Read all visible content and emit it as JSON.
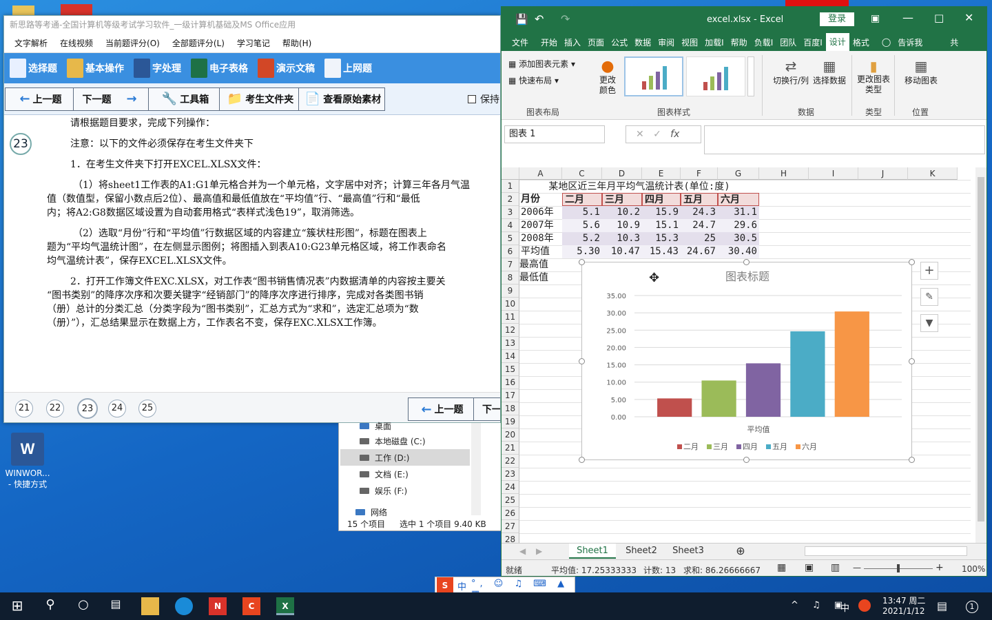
{
  "exam": {
    "title": "新思路等考通-全国计算机等级考试学习软件_一级计算机基础及MS Office应用",
    "menu": [
      "文字解析",
      "在线视频",
      "当前题评分(O)",
      "全部题评分(L)",
      "学习笔记",
      "帮助(H)"
    ],
    "modules": [
      "选择题",
      "基本操作",
      "字处理",
      "电子表格",
      "演示文稿",
      "上网题"
    ],
    "nav": {
      "prev": "上一题",
      "next": "下一题",
      "toolbox": "工具箱",
      "examfolder": "考生文件夹",
      "original": "查看原始素材",
      "keep": "保持"
    },
    "question_number": "23",
    "lines": [
      "请根据题目要求，完成下列操作：",
      "注意：以下的文件必须保存在考生文件夹下",
      "1．在考生文件夹下打开EXCEL.XLSX文件：",
      "（1）将sheet1工作表的A1:G1单元格合并为一个单元格，文字居中对齐；计算三年各月气温",
      "值（数值型，保留小数点后2位）、最高值和最低值放在“平均值”行、“最高值”行和“最低",
      "内；将A2:G8数据区域设置为自动套用格式“表样式浅色19”，取消筛选。",
      "（2）选取“月份”行和“平均值”行数据区域的内容建立“簇状柱形图”，标题在图表上",
      "题为“平均气温统计图”，在左侧显示图例；将图插入到表A10:G23单元格区域，将工作表命名",
      "均气温统计表”，保存EXCEL.XLSX文件。",
      "2．打开工作簿文件EXC.XLSX，对工作表“图书销售情况表”内数据清单的内容按主要关",
      "“图书类别”的降序次序和次要关键字“经销部门”的降序次序进行排序，完成对各类图书销",
      "（册）总计的分类汇总（分类字段为“图书类别”，汇总方式为“求和”，选定汇总项为“数",
      "（册）”），汇总结果显示在数据上方，工作表名不变，保存EXC.XLSX工作簿。"
    ],
    "pages": [
      "21",
      "22",
      "23",
      "24",
      "25"
    ],
    "footer_prev": "上一题",
    "footer_next": "下一"
  },
  "explorer": {
    "items": [
      "桌面",
      "本地磁盘 (C:)",
      "工作 (D:)",
      "文档 (E:)",
      "娱乐 (F:)",
      "网络"
    ],
    "status_count": "15 个项目",
    "status_selected": "选中 1 个项目  9.40 KB"
  },
  "desktop": {
    "word_label": "WINWOR...",
    "word_sub": "- 快捷方式"
  },
  "excel": {
    "title": "excel.xlsx  -  Excel",
    "login": "登录",
    "tabs": [
      "文件",
      "开始",
      "插入",
      "页面",
      "公式",
      "数据",
      "审阅",
      "视图",
      "加载I",
      "帮助",
      "负载I",
      "团队",
      "百度I",
      "设计",
      "格式"
    ],
    "tell": "告诉我",
    "share": "共",
    "ribbon": {
      "add_element": "添加图表元素",
      "quick_layout": "快速布局",
      "change_color": "更改颜色",
      "switch_rowcol": "切换行/列",
      "select_data": "选择数据",
      "change_type": "更改图表类型",
      "move_chart": "移动图表",
      "groups": [
        "图表布局",
        "图表样式",
        "数据",
        "类型",
        "位置"
      ]
    },
    "namebox": "图表 1",
    "fx": "fx",
    "columns": [
      "A",
      "C",
      "D",
      "E",
      "F",
      "G",
      "H",
      "I",
      "J",
      "K"
    ],
    "rows": [
      "1",
      "2",
      "3",
      "4",
      "5",
      "6",
      "7",
      "8",
      "9",
      "10",
      "11",
      "12",
      "13",
      "14",
      "15",
      "16",
      "17",
      "18",
      "19",
      "20",
      "21",
      "22",
      "23",
      "24",
      "25",
      "26",
      "27",
      "28"
    ],
    "sheet_title": "某地区近三年月平均气温统计表(单位:度)",
    "table": [
      [
        "月份",
        "二月",
        "三月",
        "四月",
        "五月",
        "六月"
      ],
      [
        "2006年",
        "5.1",
        "10.2",
        "15.9",
        "24.3",
        "31.1"
      ],
      [
        "2007年",
        "5.6",
        "10.9",
        "15.1",
        "24.7",
        "29.6"
      ],
      [
        "2008年",
        "5.2",
        "10.3",
        "15.3",
        "25",
        "30.5"
      ],
      [
        "平均值",
        "5.30",
        "10.47",
        "15.43",
        "24.67",
        "30.40"
      ],
      [
        "最高值",
        "",
        "",
        "",
        "",
        ""
      ],
      [
        "最低值",
        "",
        "",
        "",
        "",
        ""
      ]
    ],
    "sheets": [
      "Sheet1",
      "Sheet2",
      "Sheet3"
    ],
    "status": {
      "ready": "就绪",
      "avg": "平均值: 17.25333333",
      "count": "计数: 13",
      "sum": "求和: 86.26666667",
      "zoom": "100%"
    }
  },
  "chart_data": {
    "type": "bar",
    "title": "图表标题",
    "categories": [
      "平均值"
    ],
    "series": [
      {
        "name": "二月",
        "values": [
          5.3
        ],
        "color": "#c0504d"
      },
      {
        "name": "三月",
        "values": [
          10.47
        ],
        "color": "#9bbb59"
      },
      {
        "name": "四月",
        "values": [
          15.43
        ],
        "color": "#8064a2"
      },
      {
        "name": "五月",
        "values": [
          24.67
        ],
        "color": "#4bacc6"
      },
      {
        "name": "六月",
        "values": [
          30.4
        ],
        "color": "#f79646"
      }
    ],
    "yticks": [
      "0.00",
      "5.00",
      "10.00",
      "15.00",
      "20.00",
      "25.00",
      "30.00",
      "35.00"
    ],
    "ylim": [
      0,
      35
    ],
    "xlabel": "平均值",
    "legend": "bottom",
    "grid": true
  },
  "taskbar": {
    "time": "13:47 周二",
    "date": "2021/1/12",
    "ime": "中",
    "notif": "1"
  }
}
